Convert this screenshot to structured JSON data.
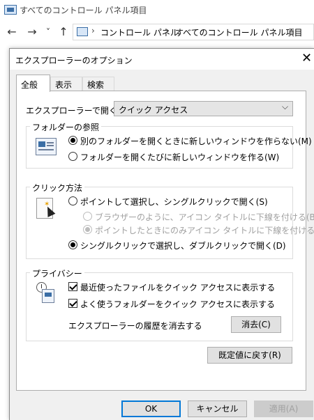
{
  "explorer": {
    "window_title": "すべてのコントロール パネル項目",
    "nav": {
      "back": "←",
      "forward": "→",
      "recent": "˅",
      "up": "↑"
    },
    "breadcrumb": [
      "コントロール パネル",
      "すべてのコントロール パネル項目"
    ],
    "breadcrumb_separator": "›"
  },
  "dialog": {
    "title": "エクスプローラーのオプション",
    "close_glyph": "✕",
    "tabs": [
      {
        "label": "全般",
        "active": true
      },
      {
        "label": "表示",
        "active": false
      },
      {
        "label": "検索",
        "active": false
      }
    ],
    "open_in": {
      "label": "エクスプローラーで開く:",
      "selected": "クイック アクセス",
      "arrow": "⌵"
    },
    "browse_folders": {
      "title": "フォルダーの参照",
      "options": [
        {
          "label": "別のフォルダーを開くときに新しいウィンドウを作らない(M)",
          "checked": true
        },
        {
          "label": "フォルダーを開くたびに新しいウィンドウを作る(W)",
          "checked": false
        }
      ]
    },
    "click_items": {
      "title": "クリック方法",
      "single_click": {
        "label": "ポイントして選択し、シングルクリックで開く(S)",
        "checked": false
      },
      "sub_options": [
        {
          "label": "ブラウザーのように、アイコン タイトルに下線を付ける(B)",
          "checked": false,
          "disabled": true
        },
        {
          "label": "ポイントしたときにのみアイコン タイトルに下線を付ける(P)",
          "checked": true,
          "disabled": true
        }
      ],
      "double_click": {
        "label": "シングルクリックで選択し、ダブルクリックで開く(D)",
        "checked": true
      }
    },
    "privacy": {
      "title": "プライバシー",
      "checks": [
        {
          "label": "最近使ったファイルをクイック アクセスに表示する",
          "checked": true
        },
        {
          "label": "よく使うフォルダーをクイック アクセスに表示する",
          "checked": true
        }
      ],
      "clear_label": "エクスプローラーの履歴を消去する",
      "clear_button": "消去(C)"
    },
    "restore_defaults": "既定値に戻す(R)",
    "buttons": {
      "ok": "OK",
      "cancel": "キャンセル",
      "apply": "適用(A)"
    }
  },
  "colors": {
    "accent": "#0078d7",
    "panel": "#ffffff",
    "dialog_bg": "#f0f0f0"
  }
}
